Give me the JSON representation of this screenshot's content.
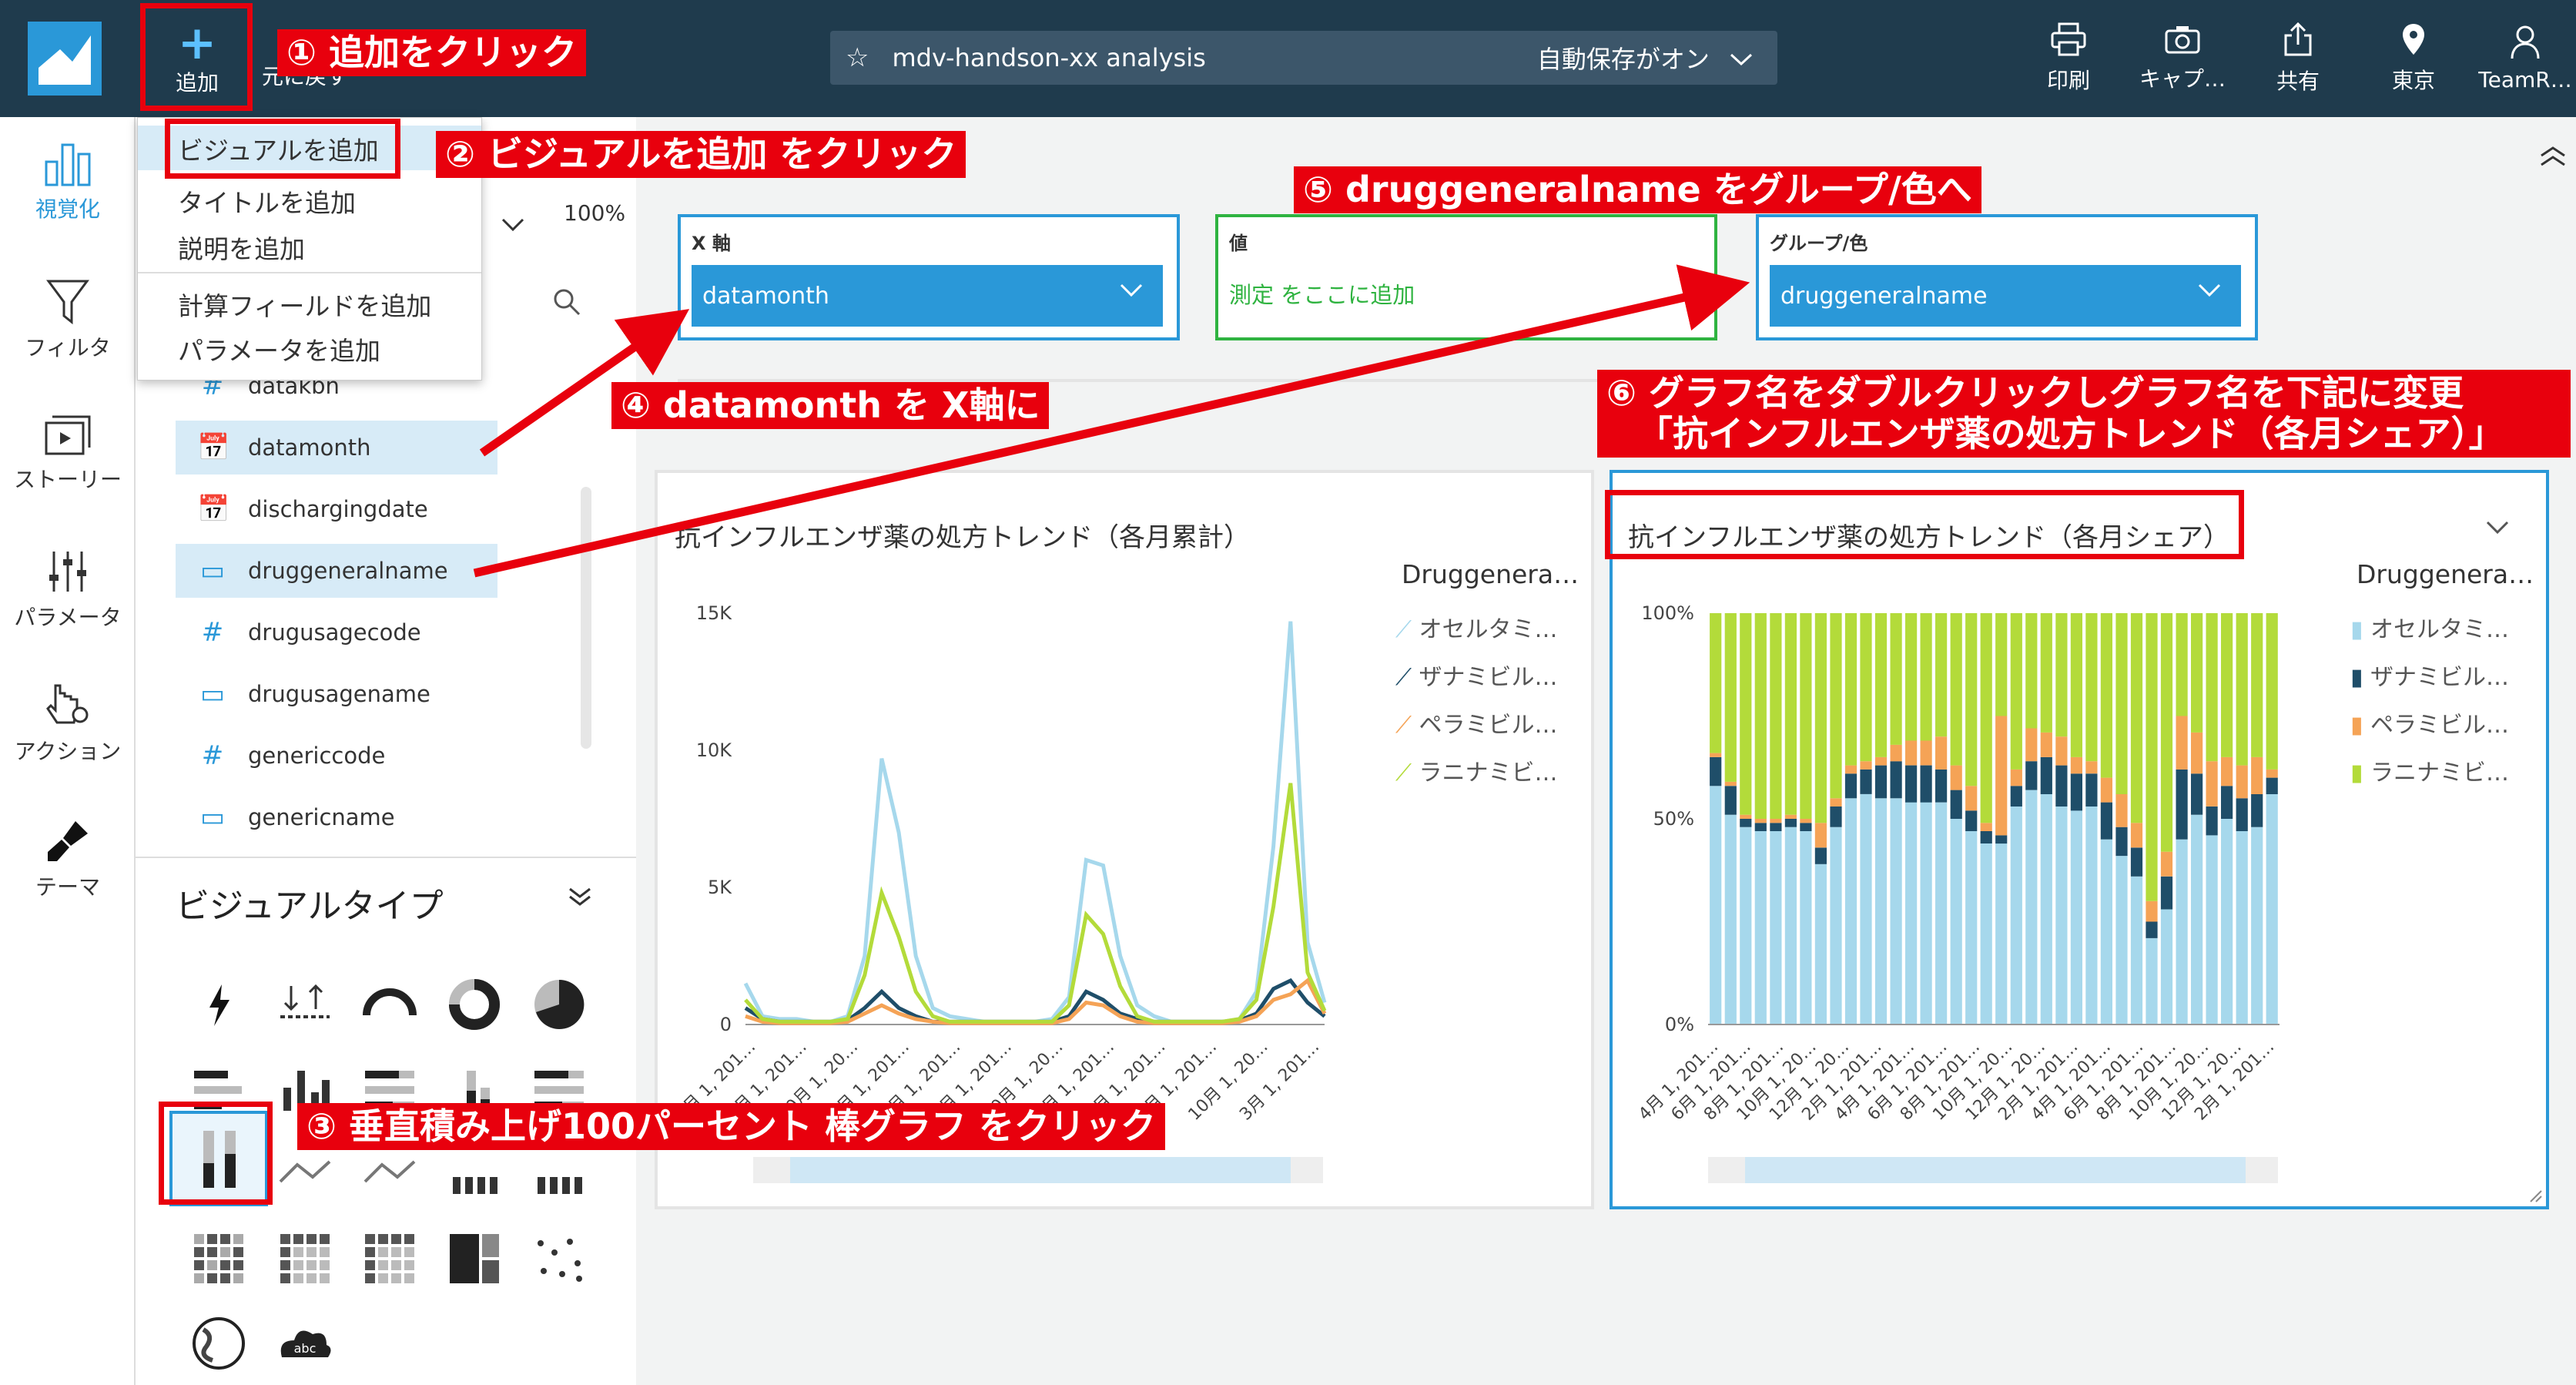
{
  "topbar": {
    "add_label": "追加",
    "undo_label": "元に戻す",
    "analysis_title": "mdv-handson-xx analysis",
    "autosave": "自動保存がオン",
    "actions": [
      {
        "label": "印刷",
        "icon": "printer-icon"
      },
      {
        "label": "キャプ…",
        "icon": "camera-icon"
      },
      {
        "label": "共有",
        "icon": "share-icon"
      },
      {
        "label": "東京",
        "icon": "location-pin-icon"
      },
      {
        "label": "TeamR…",
        "icon": "user-icon"
      }
    ]
  },
  "rail": [
    {
      "label": "視覚化",
      "icon": "bar-chart-icon",
      "active": true
    },
    {
      "label": "フィルタ",
      "icon": "filter-icon"
    },
    {
      "label": "ストーリー",
      "icon": "story-icon"
    },
    {
      "label": "パラメータ",
      "icon": "sliders-icon"
    },
    {
      "label": "アクション",
      "icon": "action-icon"
    },
    {
      "label": "テーマ",
      "icon": "brush-icon"
    }
  ],
  "dropdown": {
    "items": [
      "ビジュアルを追加",
      "タイトルを追加",
      "説明を追加",
      "計算フィールドを追加",
      "パラメータを追加"
    ]
  },
  "fieldpanel": {
    "zoom": "100%",
    "fields": [
      {
        "name": "datakbn",
        "type": "number"
      },
      {
        "name": "datamonth",
        "type": "date",
        "selected": true
      },
      {
        "name": "dischargingdate",
        "type": "date"
      },
      {
        "name": "druggeneralname",
        "type": "text",
        "selected": true
      },
      {
        "name": "drugusagecode",
        "type": "number"
      },
      {
        "name": "drugusagename",
        "type": "text"
      },
      {
        "name": "genericcode",
        "type": "number"
      },
      {
        "name": "genericname",
        "type": "text"
      }
    ]
  },
  "visual_types": {
    "title": "ビジュアルタイプ"
  },
  "wells": {
    "x_label": "X 軸",
    "x_value": "datamonth",
    "value_label": "値",
    "value_placeholder": "測定 をここに追加",
    "group_label": "グループ/色",
    "group_value": "druggeneralname"
  },
  "annotations": {
    "a1": "① 追加をクリック",
    "a2": "② ビジュアルを追加 をクリック",
    "a3": "③ 垂直積み上げ100パーセント 棒グラフ をクリック",
    "a4": "④ datamonth を X軸に",
    "a5": "⑤ druggeneralname をグループ/色へ",
    "a6_line1": "⑥ グラフ名をダブルクリックしグラフ名を下記に変更",
    "a6_line2": "「抗インフルエンザ薬の処方トレンド（各月シェア）」"
  },
  "colors": {
    "oseltamivir": "#a6d8ec",
    "zanamivir": "#1f4e69",
    "peramivir": "#f5a356",
    "laninamivir": "#b3db3a"
  },
  "chart_data": [
    {
      "type": "line",
      "title": "抗インフルエンザ薬の処方トレンド（各月累計）",
      "legend_title": "Druggenera…",
      "yticks": [
        "15K",
        "10K",
        "5K",
        "0"
      ],
      "ylim": [
        0,
        15000
      ],
      "xticks": [
        "4月 1, 201…",
        "7月 1, 201…",
        "10月 1, 20…",
        "1月 1, 201…",
        "4月 1, 201…",
        "7月 1, 201…",
        "10月 1, 20…",
        "1月 1, 201…",
        "4月 1, 201…",
        "7月 1, 201…",
        "10月 1, 20…",
        "3月 1, 201…"
      ],
      "series": [
        {
          "name": "オセルタミ…",
          "values": [
            1500,
            300,
            200,
            200,
            100,
            100,
            300,
            2500,
            9700,
            7000,
            2500,
            600,
            300,
            200,
            100,
            100,
            100,
            100,
            200,
            1000,
            6000,
            5800,
            2500,
            700,
            300,
            100,
            100,
            100,
            100,
            200,
            1200,
            6500,
            14700,
            3000,
            800
          ]
        },
        {
          "name": "ザナミビル…",
          "values": [
            600,
            200,
            100,
            100,
            100,
            100,
            150,
            600,
            1200,
            600,
            300,
            100,
            100,
            100,
            100,
            100,
            100,
            100,
            100,
            300,
            1200,
            900,
            400,
            200,
            100,
            100,
            100,
            100,
            100,
            150,
            400,
            1300,
            1600,
            800,
            300
          ]
        },
        {
          "name": "ペラミビル…",
          "values": [
            300,
            100,
            50,
            50,
            50,
            50,
            100,
            400,
            700,
            400,
            200,
            100,
            50,
            50,
            50,
            50,
            50,
            50,
            50,
            200,
            800,
            700,
            300,
            100,
            50,
            50,
            50,
            50,
            50,
            100,
            300,
            900,
            1100,
            1600,
            400
          ]
        },
        {
          "name": "ラニナミビ…",
          "values": [
            900,
            200,
            100,
            100,
            100,
            100,
            200,
            1800,
            4800,
            3200,
            1200,
            300,
            100,
            100,
            100,
            100,
            100,
            100,
            100,
            700,
            4000,
            3300,
            1400,
            300,
            100,
            100,
            100,
            100,
            100,
            200,
            900,
            4300,
            8800,
            1900,
            500
          ]
        }
      ]
    },
    {
      "type": "bar",
      "stacked": "percent",
      "title": "抗インフルエンザ薬の処方トレンド（各月シェア）",
      "legend_title": "Druggenera…",
      "yticks": [
        "100%",
        "50%",
        "0%"
      ],
      "ylim": [
        0,
        100
      ],
      "xticks": [
        "4月 1, 201…",
        "6月 1, 201…",
        "8月 1, 201…",
        "10月 1, 20…",
        "12月 1, 20…",
        "2月 1, 201…",
        "4月 1, 201…",
        "6月 1, 201…",
        "8月 1, 201…",
        "10月 1, 20…",
        "12月 1, 20…",
        "2月 1, 201…",
        "4月 1, 201…",
        "6月 1, 201…",
        "8月 1, 201…",
        "10月 1, 20…",
        "12月 1, 20…",
        "2月 1, 201…"
      ],
      "series": [
        {
          "name": "オセルタミ…",
          "values": [
            58,
            51,
            48,
            47,
            47,
            48,
            47,
            39,
            48,
            55,
            56,
            55,
            55,
            54,
            54,
            54,
            50,
            47,
            44,
            44,
            53,
            57,
            56,
            53,
            52,
            53,
            45,
            41,
            36,
            21,
            28,
            45,
            51,
            46,
            50,
            47,
            48,
            56
          ]
        },
        {
          "name": "ザナミビル…",
          "values": [
            7,
            7,
            2,
            2,
            2,
            2,
            2,
            4,
            5,
            6,
            6,
            8,
            9,
            9,
            9,
            8,
            7,
            5,
            3,
            2,
            5,
            7,
            9,
            10,
            9,
            8,
            9,
            7,
            7,
            4,
            8,
            17,
            10,
            7,
            8,
            8,
            8,
            4
          ]
        },
        {
          "name": "ペラミビル…",
          "values": [
            1,
            1,
            1,
            1,
            1,
            1,
            1,
            6,
            2,
            2,
            2,
            2,
            4,
            6,
            6,
            8,
            6,
            6,
            2,
            29,
            4,
            8,
            6,
            7,
            4,
            3,
            6,
            8,
            6,
            5,
            6,
            13,
            10,
            11,
            7,
            8,
            9,
            2
          ]
        },
        {
          "name": "ラニナミビ…",
          "values": [
            34,
            41,
            49,
            50,
            50,
            49,
            50,
            51,
            45,
            37,
            36,
            35,
            32,
            31,
            31,
            30,
            37,
            42,
            51,
            25,
            38,
            28,
            29,
            30,
            35,
            36,
            40,
            44,
            51,
            70,
            58,
            25,
            29,
            36,
            35,
            37,
            35,
            38
          ]
        }
      ]
    }
  ]
}
